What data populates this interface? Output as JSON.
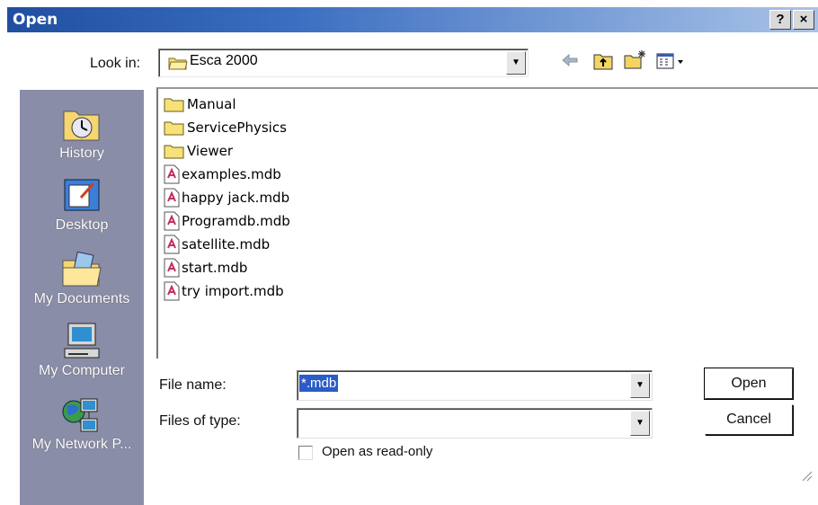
{
  "window": {
    "title": "Open",
    "help_label": "?",
    "close_label": "×"
  },
  "lookin": {
    "label": "Look in:",
    "value": "Esca 2000"
  },
  "places": [
    {
      "label": "History",
      "icon": "history-icon"
    },
    {
      "label": "Desktop",
      "icon": "desktop-icon"
    },
    {
      "label": "My Documents",
      "icon": "my-documents-icon"
    },
    {
      "label": "My Computer",
      "icon": "my-computer-icon"
    },
    {
      "label": "My Network P...",
      "icon": "my-network-places-icon"
    }
  ],
  "files": [
    {
      "name": "Manual",
      "type": "folder"
    },
    {
      "name": "ServicePhysics",
      "type": "folder"
    },
    {
      "name": "Viewer",
      "type": "folder"
    },
    {
      "name": "examples.mdb",
      "type": "mdb"
    },
    {
      "name": "happy jack.mdb",
      "type": "mdb"
    },
    {
      "name": "Programdb.mdb",
      "type": "mdb"
    },
    {
      "name": "satellite.mdb",
      "type": "mdb"
    },
    {
      "name": "start.mdb",
      "type": "mdb"
    },
    {
      "name": "try import.mdb",
      "type": "mdb"
    }
  ],
  "filename": {
    "label": "File name:",
    "value": "*.mdb"
  },
  "filetype": {
    "label": "Files of type:",
    "value": ""
  },
  "readonly": {
    "label": "Open as read-only",
    "checked": false
  },
  "buttons": {
    "open": "Open",
    "cancel": "Cancel"
  },
  "colors": {
    "title_bar": "#1f4fa0",
    "places_bar": "#8a8da8",
    "selection": "#2a5cc8"
  }
}
